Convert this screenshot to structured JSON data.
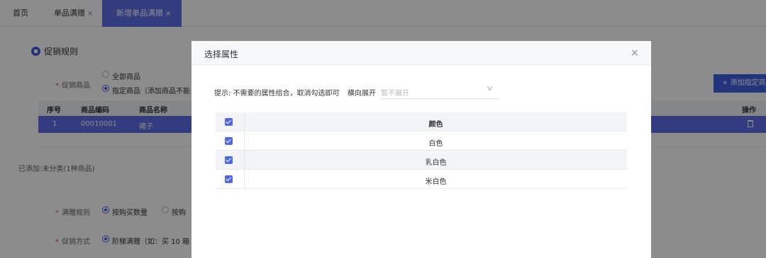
{
  "tabs": {
    "home": "首页",
    "promo": "单品满赠",
    "new": "新增单品满赠",
    "close": "×"
  },
  "page": {
    "section_title": "促销规则",
    "promo_goods_label": "促销商品",
    "radio_all": "全部商品",
    "radio_specified": "指定商品（添加商品不能",
    "add_button": "+ 添加指定商",
    "table_headers": [
      "序号",
      "商品编码",
      "商品名称"
    ],
    "operation_header": "操作",
    "row": {
      "index": "1",
      "code": "00010001",
      "name": "裙子"
    },
    "added_note": "已添加:未分类(1种商品)",
    "rule_label": "满赠规则",
    "rule_option_1": "按购买数量",
    "rule_option_2": "按购",
    "method_label": "促销方式",
    "method_option": "阶梯满赠（如：买 10 箱"
  },
  "modal": {
    "title": "选择属性",
    "close": "×",
    "hint": "提示: 不需要的属性组合，取消勾选即可",
    "expand_label": "横向展开",
    "expand_placeholder": "暂不展开",
    "expand_chevron": "∨",
    "table_header": "颜色",
    "rows": [
      "白色",
      "乳白色",
      "米白色"
    ]
  },
  "colors": {
    "accent": "#5b6ee6",
    "checkbox": "#4e68e8",
    "primary_button": "#3f5fe0"
  }
}
